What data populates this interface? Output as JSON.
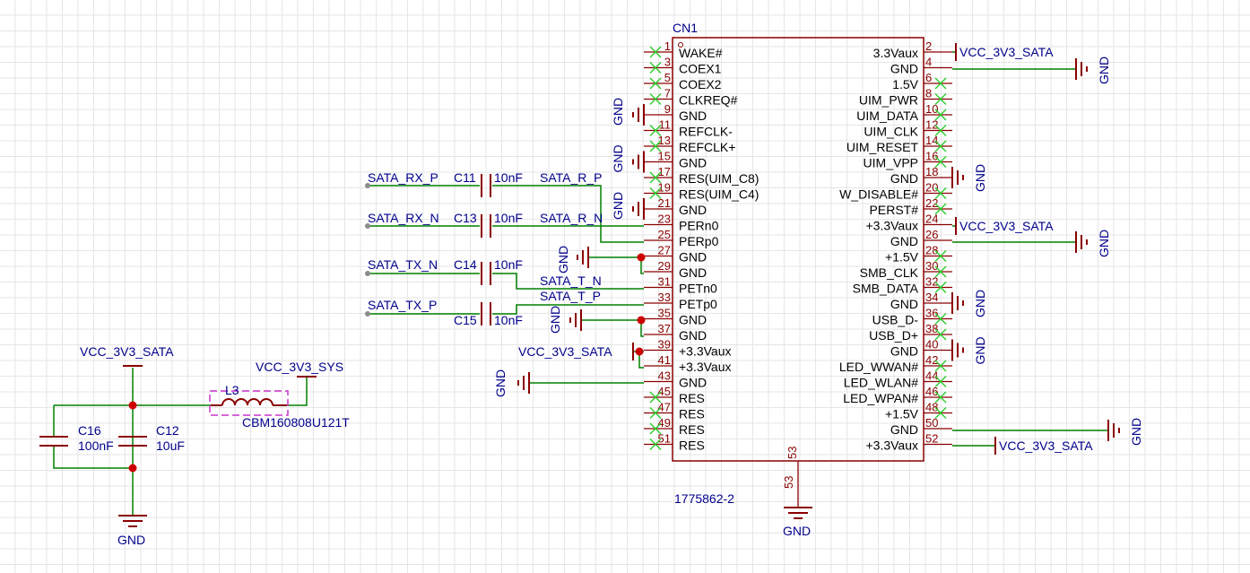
{
  "connector": {
    "designator": "CN1",
    "part_number": "1775862-2",
    "pin53_name": "53",
    "pin53_number": "53",
    "left_pins": [
      {
        "num": "1",
        "name": "WAKE#",
        "nc": true
      },
      {
        "num": "3",
        "name": "COEX1",
        "nc": true
      },
      {
        "num": "5",
        "name": "COEX2",
        "nc": true
      },
      {
        "num": "7",
        "name": "CLKREQ#",
        "nc": true
      },
      {
        "num": "9",
        "name": "GND",
        "nc": false
      },
      {
        "num": "11",
        "name": "REFCLK-",
        "nc": true
      },
      {
        "num": "13",
        "name": "REFCLK+",
        "nc": true
      },
      {
        "num": "15",
        "name": "GND",
        "nc": false
      },
      {
        "num": "17",
        "name": "RES(UIM_C8)",
        "nc": true
      },
      {
        "num": "19",
        "name": "RES(UIM_C4)",
        "nc": true
      },
      {
        "num": "21",
        "name": "GND",
        "nc": false
      },
      {
        "num": "23",
        "name": "PERn0",
        "nc": false
      },
      {
        "num": "25",
        "name": "PERp0",
        "nc": false
      },
      {
        "num": "27",
        "name": "GND",
        "nc": false
      },
      {
        "num": "29",
        "name": "GND",
        "nc": false
      },
      {
        "num": "31",
        "name": "PETn0",
        "nc": false
      },
      {
        "num": "33",
        "name": "PETp0",
        "nc": false
      },
      {
        "num": "35",
        "name": "GND",
        "nc": false
      },
      {
        "num": "37",
        "name": "GND",
        "nc": false
      },
      {
        "num": "39",
        "name": "+3.3Vaux",
        "nc": false
      },
      {
        "num": "41",
        "name": "+3.3Vaux",
        "nc": false
      },
      {
        "num": "43",
        "name": "GND",
        "nc": false
      },
      {
        "num": "45",
        "name": "RES",
        "nc": true
      },
      {
        "num": "47",
        "name": "RES",
        "nc": true
      },
      {
        "num": "49",
        "name": "RES",
        "nc": true
      },
      {
        "num": "51",
        "name": "RES",
        "nc": true
      }
    ],
    "right_pins": [
      {
        "num": "2",
        "name": "3.3Vaux",
        "nc": false
      },
      {
        "num": "4",
        "name": "GND",
        "nc": false
      },
      {
        "num": "6",
        "name": "1.5V",
        "nc": true
      },
      {
        "num": "8",
        "name": "UIM_PWR",
        "nc": true
      },
      {
        "num": "10",
        "name": "UIM_DATA",
        "nc": true
      },
      {
        "num": "12",
        "name": "UIM_CLK",
        "nc": true
      },
      {
        "num": "14",
        "name": "UIM_RESET",
        "nc": true
      },
      {
        "num": "16",
        "name": "UIM_VPP",
        "nc": true
      },
      {
        "num": "18",
        "name": "GND",
        "nc": false
      },
      {
        "num": "20",
        "name": "W_DISABLE#",
        "nc": true
      },
      {
        "num": "22",
        "name": "PERST#",
        "nc": true
      },
      {
        "num": "24",
        "name": "+3.3Vaux",
        "nc": false
      },
      {
        "num": "26",
        "name": "GND",
        "nc": false
      },
      {
        "num": "28",
        "name": "+1.5V",
        "nc": true
      },
      {
        "num": "30",
        "name": "SMB_CLK",
        "nc": true
      },
      {
        "num": "32",
        "name": "SMB_DATA",
        "nc": true
      },
      {
        "num": "34",
        "name": "GND",
        "nc": false
      },
      {
        "num": "36",
        "name": "USB_D-",
        "nc": true
      },
      {
        "num": "38",
        "name": "USB_D+",
        "nc": true
      },
      {
        "num": "40",
        "name": "GND",
        "nc": false
      },
      {
        "num": "42",
        "name": "LED_WWAN#",
        "nc": true
      },
      {
        "num": "44",
        "name": "LED_WLAN#",
        "nc": true
      },
      {
        "num": "46",
        "name": "LED_WPAN#",
        "nc": true
      },
      {
        "num": "48",
        "name": "+1.5V",
        "nc": true
      },
      {
        "num": "50",
        "name": "GND",
        "nc": false
      },
      {
        "num": "52",
        "name": "+3.3Vaux",
        "nc": false
      }
    ]
  },
  "nets": {
    "sata_rx_p": "SATA_RX_P",
    "sata_rx_n": "SATA_RX_N",
    "sata_tx_n": "SATA_TX_N",
    "sata_tx_p": "SATA_TX_P",
    "sata_r_p": "SATA_R_P",
    "sata_r_n": "SATA_R_N",
    "sata_t_n": "SATA_T_N",
    "sata_t_p": "SATA_T_P"
  },
  "power": {
    "vcc_sata": "VCC_3V3_SATA",
    "vcc_sys": "VCC_3V3_SYS",
    "gnd": "GND"
  },
  "components": {
    "c11": {
      "ref": "C11",
      "value": "10nF"
    },
    "c13": {
      "ref": "C13",
      "value": "10nF"
    },
    "c14": {
      "ref": "C14",
      "value": "10nF"
    },
    "c15": {
      "ref": "C15",
      "value": "10nF"
    },
    "c16": {
      "ref": "C16",
      "value": "100nF"
    },
    "c12": {
      "ref": "C12",
      "value": "10uF"
    },
    "l3": {
      "ref": "L3",
      "value": "CBM160808U121T"
    }
  },
  "colors": {
    "wire": "#008000",
    "body": "#8b0000",
    "label": "#00008b",
    "junction": "#cc0000",
    "noconnect": "#33cc33",
    "highlight": "#cc33cc"
  }
}
